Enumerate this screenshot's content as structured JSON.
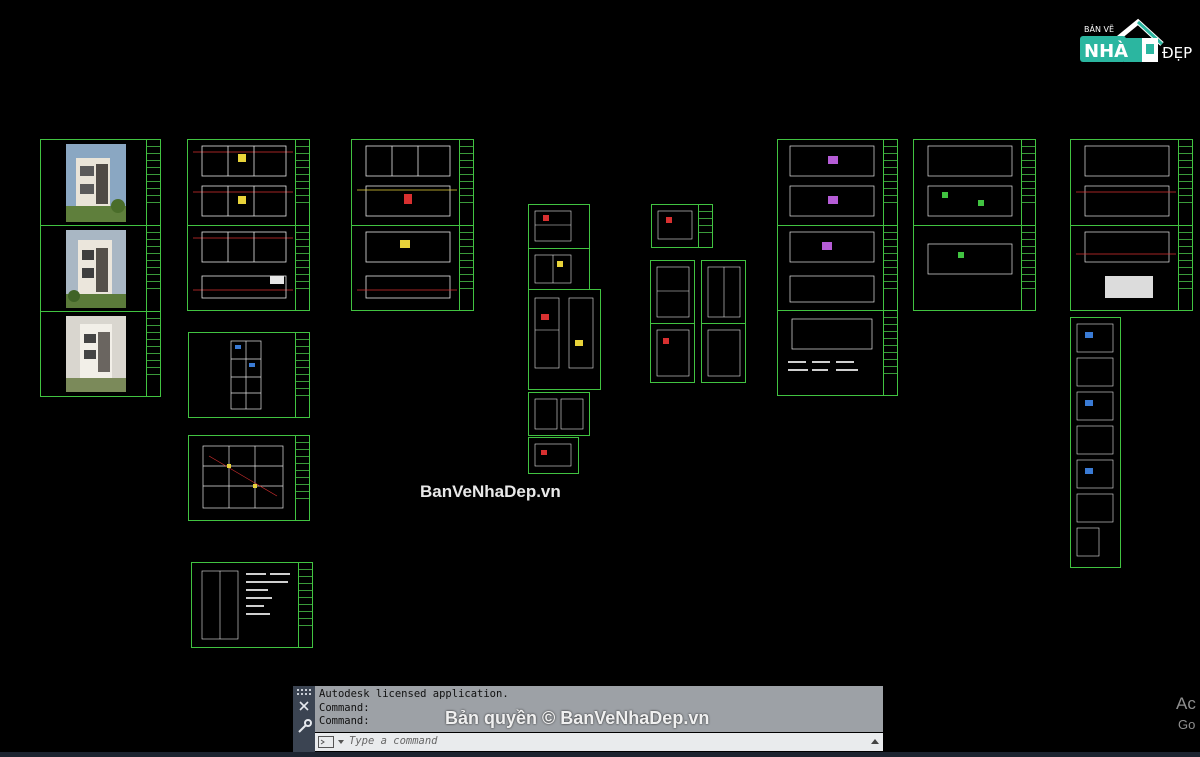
{
  "watermarks": {
    "center": "BanVeNhaDep.vn",
    "copyright": "Bản quyền © BanVeNhaDep.vn"
  },
  "logo": {
    "top": "BẢN VẼ",
    "left": "NHÀ",
    "right": "ĐẸP"
  },
  "command_line": {
    "history": [
      "Autodesk licensed application.",
      "Command:",
      "Command:"
    ],
    "placeholder": "Type a command"
  },
  "windows_activation": {
    "line1": "Ac",
    "line2": "Go"
  },
  "colors": {
    "background": "#000000",
    "sheet_border": "#41c341",
    "drawing_red": "#d83030",
    "drawing_yellow": "#e8d33a",
    "drawing_white": "#e6e6e6"
  }
}
